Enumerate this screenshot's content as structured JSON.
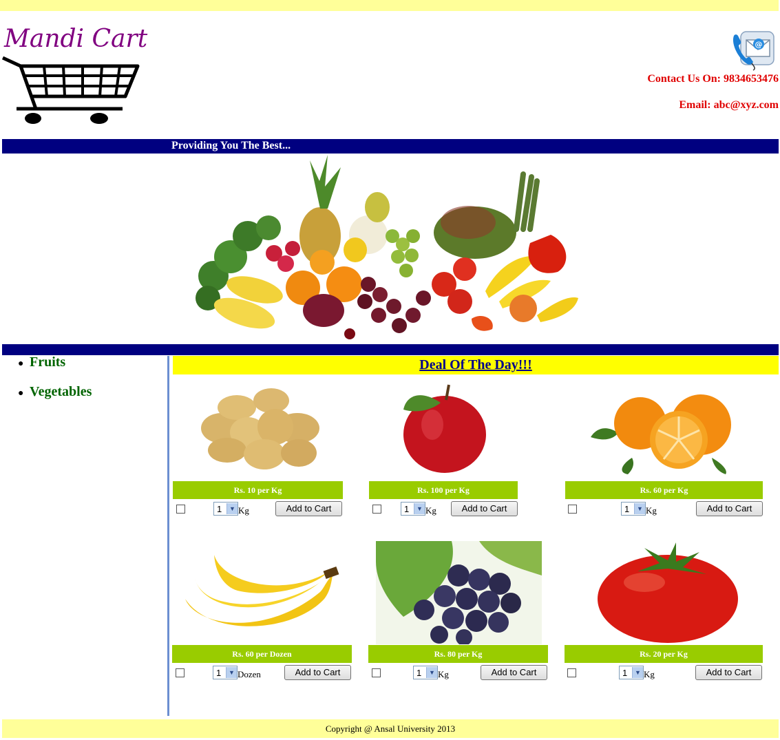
{
  "header": {
    "logo_text": "Mandi Cart",
    "contact": "Contact Us On: 9834653476",
    "email": "Email: abc@xyz.com",
    "tagline": "Providing You The Best..."
  },
  "sidebar": {
    "items": [
      {
        "label": "Fruits"
      },
      {
        "label": "Vegetables"
      }
    ]
  },
  "deal_title": "Deal Of The Day!!!",
  "products": [
    {
      "icon": "potatoes-image",
      "price": "Rs. 10 per Kg",
      "qty": "1",
      "unit": "Kg",
      "button": "Add to Cart"
    },
    {
      "icon": "apple-image",
      "price": "Rs. 100 per Kg",
      "qty": "1",
      "unit": "Kg",
      "button": "Add to Cart"
    },
    {
      "icon": "oranges-image",
      "price": "Rs. 60 per Kg",
      "qty": "1",
      "unit": "Kg",
      "button": "Add to Cart"
    },
    {
      "icon": "bananas-image",
      "price": "Rs. 60 per Dozen",
      "qty": "1",
      "unit": "Dozen",
      "button": "Add to Cart"
    },
    {
      "icon": "grapes-image",
      "price": "Rs. 80 per Kg",
      "qty": "1",
      "unit": "Kg",
      "button": "Add to Cart"
    },
    {
      "icon": "tomato-image",
      "price": "Rs. 20 per Kg",
      "qty": "1",
      "unit": "Kg",
      "button": "Add to Cart"
    }
  ],
  "footer": "Copyright @ Ansal University 2013",
  "colors": {
    "brand": "#800080",
    "band": "#000080",
    "price_bar": "#99cc00",
    "deal_bg": "#ffff00",
    "contact": "#e00000",
    "nav": "#006400"
  }
}
